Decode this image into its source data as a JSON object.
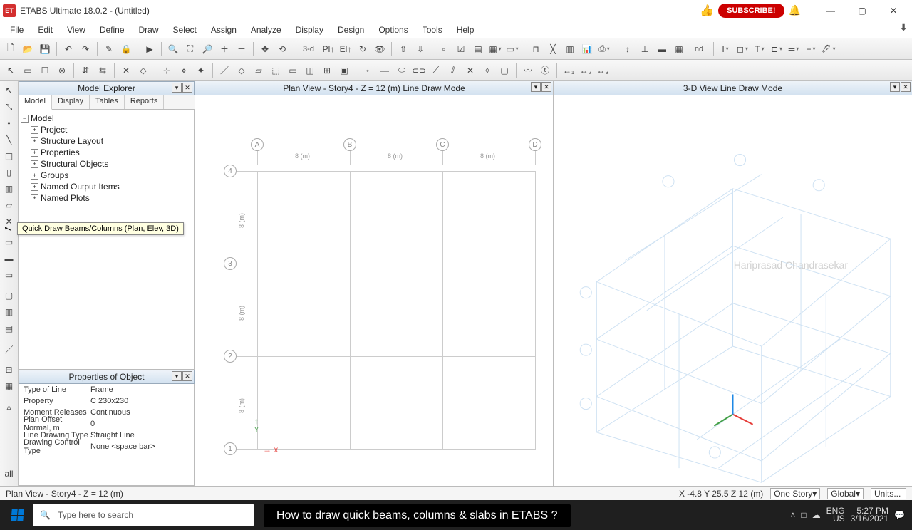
{
  "titlebar": {
    "app_icon_text": "ET",
    "title": "ETABS Ultimate 18.0.2 - (Untitled)",
    "subscribe": "SUBSCRIBE!",
    "min": "—",
    "max": "▢",
    "close": "✕"
  },
  "menubar": {
    "items": [
      "File",
      "Edit",
      "View",
      "Define",
      "Draw",
      "Select",
      "Assign",
      "Analyze",
      "Display",
      "Design",
      "Options",
      "Tools",
      "Help"
    ]
  },
  "toolbar1": {
    "three_d_label": "3-d",
    "nd_label": "nd"
  },
  "vtool_tooltip": "Quick Draw Beams/Columns (Plan, Elev, 3D)",
  "explorer": {
    "title": "Model Explorer",
    "tabs": [
      "Model",
      "Display",
      "Tables",
      "Reports"
    ],
    "root": "Model",
    "nodes": [
      "Project",
      "Structure Layout",
      "Properties",
      "Structural Objects",
      "Groups",
      "Named Output Items",
      "Named Plots"
    ]
  },
  "props": {
    "title": "Properties of Object",
    "rows": [
      {
        "k": "Type of Line",
        "v": "Frame"
      },
      {
        "k": "Property",
        "v": "C 230x230"
      },
      {
        "k": "Moment Releases",
        "v": "Continuous"
      },
      {
        "k": "Plan Offset Normal, m",
        "v": "0"
      },
      {
        "k": "Line Drawing Type",
        "v": "Straight Line"
      },
      {
        "k": "Drawing Control Type",
        "v": "None  <space bar>"
      }
    ]
  },
  "plan_view": {
    "title": "Plan View - Story4 - Z = 12 (m)  Line Draw Mode",
    "cols": [
      "A",
      "B",
      "C",
      "D"
    ],
    "rows": [
      "4",
      "3",
      "2",
      "1"
    ],
    "dims_x": [
      "8 (m)",
      "8 (m)",
      "8 (m)"
    ],
    "dims_y": [
      "8 (m)",
      "8 (m)",
      "8 (m)"
    ],
    "x_label": "X",
    "y_label": "Y"
  },
  "d3_view": {
    "title": "3-D View  Line Draw Mode",
    "watermark": "Hariprasad Chandrasekar"
  },
  "status": {
    "left": "Plan View - Story4 - Z = 12 (m)",
    "coords": "X -4.8  Y 25.5  Z 12 (m)",
    "story_sel": "One Story",
    "coord_sys": "Global",
    "units": "Units..."
  },
  "taskbar": {
    "search_placeholder": "Type here to search",
    "subtitle": "How to draw quick beams, columns & slabs in ETABS ?",
    "lang": "ENG",
    "region": "US",
    "time": "5:27 PM",
    "date": "3/16/2021"
  }
}
